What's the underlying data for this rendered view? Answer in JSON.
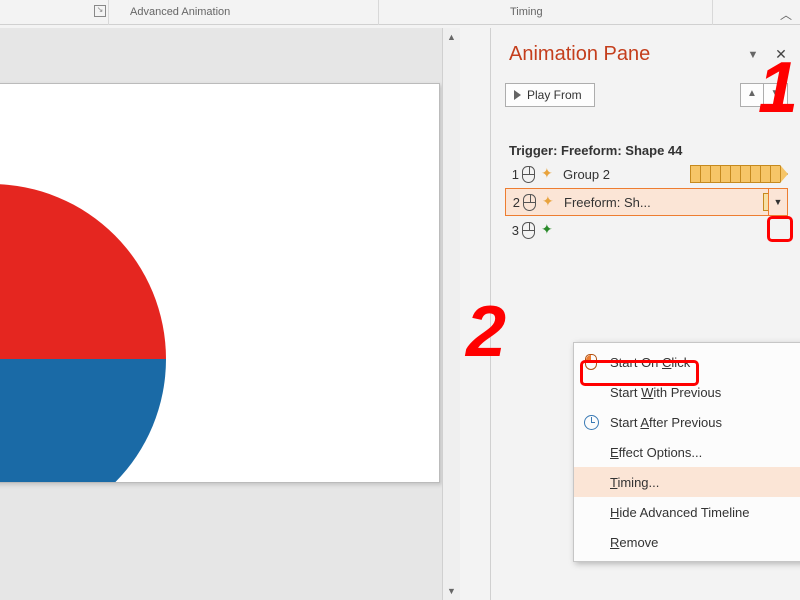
{
  "ribbon": {
    "group_adv": "Advanced Animation",
    "group_timing": "Timing"
  },
  "pane": {
    "title": "Animation Pane",
    "play_label": "Play From",
    "trigger_label": "Trigger: Freeform: Shape 44"
  },
  "items": [
    {
      "num": "1",
      "name": "Group 2"
    },
    {
      "num": "2",
      "name": "Freeform: Sh..."
    },
    {
      "num": "3",
      "name": ""
    }
  ],
  "menu": {
    "start_click_pre": "Start On ",
    "start_click_u": "C",
    "start_click_post": "lick",
    "start_with_pre": "Start ",
    "start_with_u": "W",
    "start_with_post": "ith Previous",
    "start_after_pre": "Start ",
    "start_after_u": "A",
    "start_after_post": "fter Previous",
    "effect_u": "E",
    "effect_post": "ffect Options...",
    "timing_u": "T",
    "timing_post": "iming...",
    "hide_u": "H",
    "hide_post": "ide Advanced Timeline",
    "remove_u": "R",
    "remove_post": "emove"
  },
  "callouts": {
    "one": "1",
    "two": "2"
  }
}
